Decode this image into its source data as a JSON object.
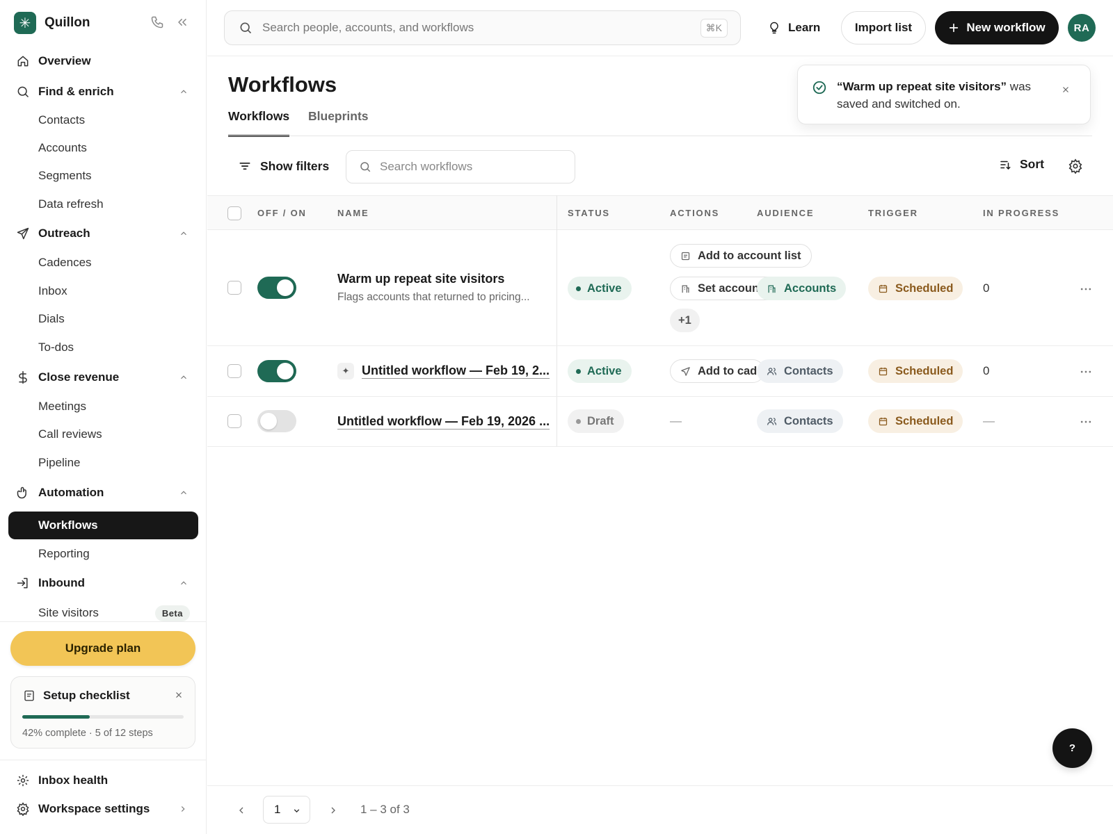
{
  "app": {
    "name": "Quillon",
    "logo_glyph": "✳"
  },
  "colors": {
    "accent": "#1f6a55",
    "upgrade": "#f2c556",
    "active_nav": "#171717"
  },
  "sidebar": {
    "overview": "Overview",
    "find_enrich": {
      "label": "Find & enrich",
      "items": [
        "Contacts",
        "Accounts",
        "Segments",
        "Data refresh"
      ]
    },
    "outreach": {
      "label": "Outreach",
      "items": [
        "Cadences",
        "Inbox",
        "Dials",
        "To-dos"
      ]
    },
    "close_revenue": {
      "label": "Close revenue",
      "items": [
        "Meetings",
        "Call reviews",
        "Pipeline"
      ]
    },
    "automation": {
      "label": "Automation",
      "items": [
        "Workflows",
        "Reporting"
      ],
      "active": "Workflows"
    },
    "inbound": {
      "label": "Inbound",
      "items": [
        "Site visitors"
      ],
      "badge": "Beta"
    },
    "upgrade": "Upgrade plan",
    "checklist": {
      "title": "Setup checklist",
      "progress": 0.42,
      "text": "42% complete · 5 of 12 steps"
    },
    "inbox_health": "Inbox health",
    "workspace_settings": "Workspace settings"
  },
  "topbar": {
    "search_placeholder": "Search people, accounts, and workflows",
    "shortcut": "⌘K",
    "learn": "Learn",
    "import": "Import list",
    "new_workflow": "New workflow",
    "avatar": "RA"
  },
  "page": {
    "title": "Workflows",
    "tabs": [
      "Workflows",
      "Blueprints"
    ],
    "active_tab": "Workflows"
  },
  "toast": {
    "name": "“Warm up repeat site visitors”",
    "message": " was saved and switched on."
  },
  "toolbar": {
    "filters": "Show filters",
    "search_placeholder": "Search workflows",
    "sort": "Sort"
  },
  "table": {
    "columns": [
      "OFF / ON",
      "NAME",
      "STATUS",
      "ACTIONS",
      "AUDIENCE",
      "TRIGGER",
      "IN PROGRESS"
    ],
    "rows": [
      {
        "on": true,
        "name": "Warm up repeat site visitors",
        "description": "Flags accounts that returned to pricing...",
        "status": "Active",
        "actions": [
          "Add to account list",
          "Set account",
          "+1"
        ],
        "audience": "Accounts",
        "trigger": "Scheduled",
        "in_progress": "0"
      },
      {
        "on": true,
        "name": "Untitled workflow — Feb 19, 2...",
        "status": "Active",
        "actions": [
          "Add to cadence"
        ],
        "audience": "Contacts",
        "trigger": "Scheduled",
        "in_progress": "0"
      },
      {
        "on": false,
        "name": "Untitled workflow — Feb 19, 2026 ...",
        "status": "Draft",
        "actions": [
          "—"
        ],
        "audience": "Contacts",
        "trigger": "Scheduled",
        "in_progress": "—"
      }
    ]
  },
  "pagination": {
    "page": "1",
    "range": "1 – 3 of 3"
  },
  "help": "?"
}
